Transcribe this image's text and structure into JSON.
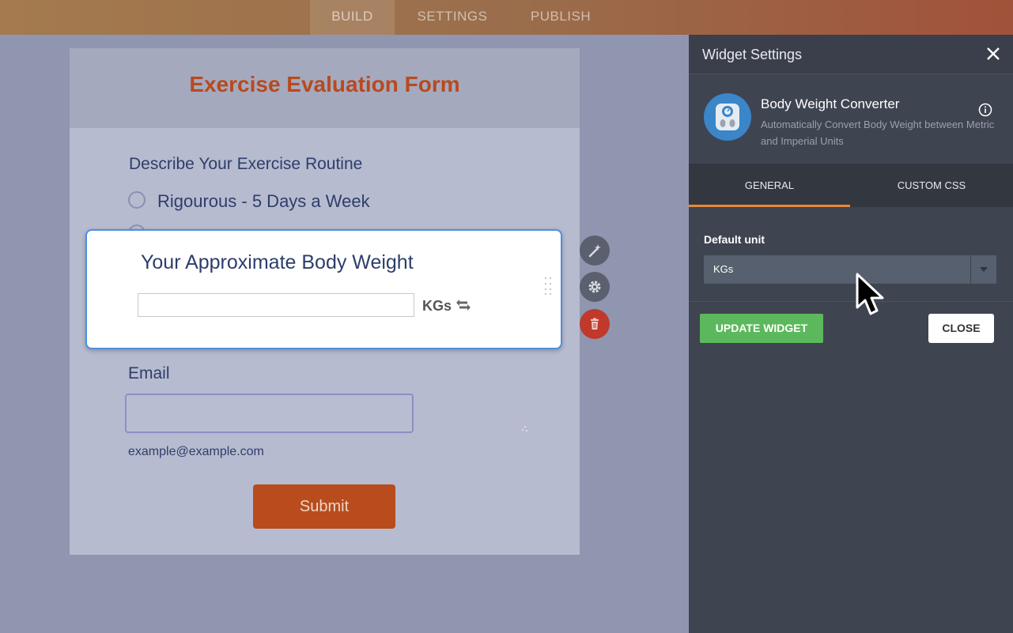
{
  "nav": {
    "tabs": [
      "BUILD",
      "SETTINGS",
      "PUBLISH"
    ],
    "active": "BUILD"
  },
  "form": {
    "title": "Exercise Evaluation Form",
    "routine_label": "Describe Your Exercise Routine",
    "routine_options": [
      "Rigourous - 5 Days a Week"
    ],
    "body_weight_label": "Your Approximate Body Weight",
    "unit": "KGs",
    "email_label": "Email",
    "email_help": "example@example.com",
    "submit_label": "Submit"
  },
  "panel": {
    "title": "Widget Settings",
    "widget_name": "Body Weight Converter",
    "widget_desc": "Automatically Convert Body Weight between Metric and Imperial Units",
    "tabs": [
      "GENERAL",
      "CUSTOM CSS"
    ],
    "active_tab": "GENERAL",
    "default_unit_label": "Default unit",
    "default_unit_value": "KGs",
    "update_label": "UPDATE WIDGET",
    "close_label": "CLOSE"
  },
  "colors": {
    "accent_orange": "#b84a1e",
    "tab_underline": "#e8883a",
    "update_green": "#5cb85c",
    "delete_red": "#c0392b",
    "selection_blue": "#4a90e2"
  },
  "icons": [
    "magic-wand-icon",
    "gear-icon",
    "trash-icon",
    "swap-icon",
    "close-icon",
    "info-icon",
    "scale-icon",
    "dropdown-arrow-icon",
    "drag-handle-icon",
    "mouse-cursor-icon"
  ]
}
